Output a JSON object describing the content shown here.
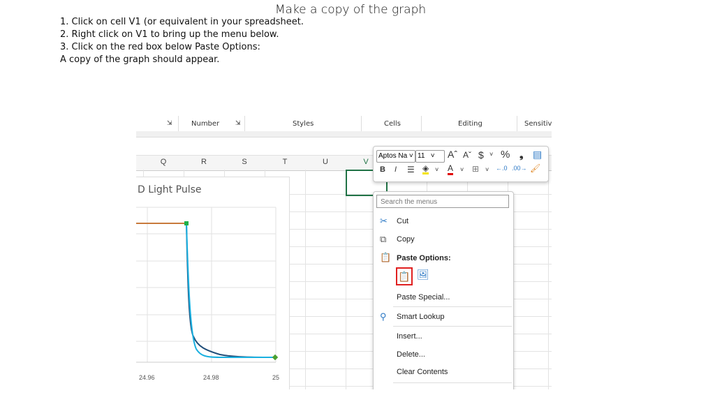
{
  "slide": {
    "title": "Make a copy of the graph",
    "instructions": [
      "1. Click on cell V1 (or equivalent in your spreadsheet.",
      "2. Right click on V1 to bring up the menu below.",
      "3. Click on the red box below Paste Options:",
      "A copy of the graph should appear."
    ]
  },
  "ribbon": {
    "groups": [
      "Number",
      "Styles",
      "Cells",
      "Editing",
      "Sensitivi"
    ]
  },
  "columns": [
    "Q",
    "R",
    "S",
    "T",
    "U",
    "V"
  ],
  "selected_cell": "V1",
  "chart": {
    "title": "D Light Pulse",
    "x_ticks": [
      "24.96",
      "24.98",
      "25"
    ],
    "colors": {
      "orange": "#c87a3c",
      "dark": "#1f4e79",
      "cyan": "#1ab0e0",
      "green": "#2ea84a"
    }
  },
  "mini_toolbar": {
    "font": "Aptos Na",
    "size": "11",
    "buttons": [
      "increase-font",
      "decrease-font",
      "currency",
      "percent",
      "comma",
      "wrap",
      "bold",
      "italic",
      "align",
      "fill-color",
      "font-color",
      "borders",
      "increase-decimal",
      "decrease-decimal",
      "format-painter"
    ],
    "bold": "B",
    "italic": "I",
    "grow": "Aˆ",
    "shrink": "Aˇ",
    "currency": "$",
    "percent": "%",
    "comma": "9"
  },
  "context_menu": {
    "search_placeholder": "Search the menus",
    "cut": "Cut",
    "copy": "Copy",
    "paste_options": "Paste Options:",
    "paste_special": "Paste Special...",
    "smart_lookup": "Smart Lookup",
    "insert": "Insert...",
    "delete": "Delete...",
    "clear_contents": "Clear Contents",
    "highlight_color": "#e02020"
  }
}
